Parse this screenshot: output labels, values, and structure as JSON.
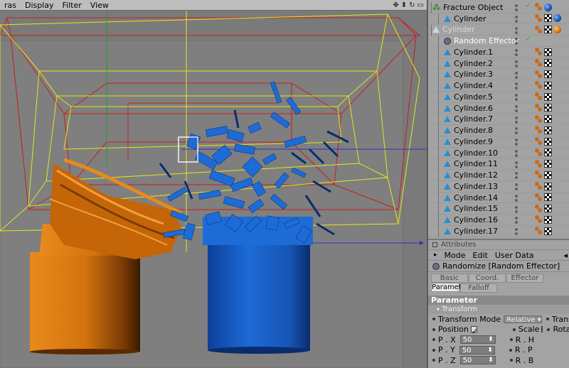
{
  "viewport": {
    "menu": [
      "ras",
      "Display",
      "Filter",
      "View"
    ]
  },
  "objects": [
    {
      "name": "Fracture Object",
      "kind": "fracture",
      "indent": 0,
      "check": "✓",
      "tags": [
        "phong",
        "sphere-blue"
      ]
    },
    {
      "name": "Cylinder",
      "kind": "tri",
      "indent": 1,
      "tags": [
        "phong",
        "check",
        "sphere-blue"
      ]
    },
    {
      "name": "Cylinder",
      "kind": "tri-ghost",
      "indent": 0,
      "tags": [
        "phong",
        "check",
        "sphere-orange"
      ]
    },
    {
      "name": "Random Effector",
      "kind": "effector",
      "indent": 1,
      "check": "✓",
      "tags": []
    },
    {
      "name": "Cylinder.1",
      "kind": "tri",
      "indent": 1,
      "tags": [
        "phong",
        "check"
      ]
    },
    {
      "name": "Cylinder.2",
      "kind": "tri",
      "indent": 1,
      "tags": [
        "phong",
        "check"
      ]
    },
    {
      "name": "Cylinder.3",
      "kind": "tri",
      "indent": 1,
      "tags": [
        "phong",
        "check"
      ]
    },
    {
      "name": "Cylinder.4",
      "kind": "tri",
      "indent": 1,
      "tags": [
        "phong",
        "check"
      ]
    },
    {
      "name": "Cylinder.5",
      "kind": "tri",
      "indent": 1,
      "tags": [
        "phong",
        "check"
      ]
    },
    {
      "name": "Cylinder.6",
      "kind": "tri",
      "indent": 1,
      "tags": [
        "phong",
        "check"
      ]
    },
    {
      "name": "Cylinder.7",
      "kind": "tri",
      "indent": 1,
      "tags": [
        "phong",
        "check"
      ]
    },
    {
      "name": "Cylinder.8",
      "kind": "tri",
      "indent": 1,
      "tags": [
        "phong",
        "check"
      ]
    },
    {
      "name": "Cylinder.9",
      "kind": "tri",
      "indent": 1,
      "tags": [
        "phong",
        "check"
      ]
    },
    {
      "name": "Cylinder.10",
      "kind": "tri",
      "indent": 1,
      "tags": [
        "phong",
        "check"
      ]
    },
    {
      "name": "Cylinder.11",
      "kind": "tri",
      "indent": 1,
      "tags": [
        "phong",
        "check"
      ]
    },
    {
      "name": "Cylinder.12",
      "kind": "tri",
      "indent": 1,
      "tags": [
        "phong",
        "check"
      ]
    },
    {
      "name": "Cylinder.13",
      "kind": "tri",
      "indent": 1,
      "tags": [
        "phong",
        "check"
      ]
    },
    {
      "name": "Cylinder.14",
      "kind": "tri",
      "indent": 1,
      "tags": [
        "phong",
        "check"
      ]
    },
    {
      "name": "Cylinder.15",
      "kind": "tri",
      "indent": 1,
      "tags": [
        "phong",
        "check"
      ]
    },
    {
      "name": "Cylinder.16",
      "kind": "tri",
      "indent": 1,
      "tags": [
        "phong",
        "check"
      ]
    },
    {
      "name": "Cylinder.17",
      "kind": "tri",
      "indent": 1,
      "tags": [
        "phong",
        "check"
      ]
    }
  ],
  "attributes": {
    "header": "Attributes",
    "menu": [
      "Mode",
      "Edit",
      "User Data"
    ],
    "title": "Randomize [Random Effector]",
    "tabs": [
      "Basic",
      "Coord.",
      "Effector",
      "Parameter",
      "Falloff"
    ],
    "active_tab": "Parameter",
    "section": "Parameter",
    "subsection": "Transform",
    "transform_mode_label": "Transform Mode",
    "transform_mode_value": "Relative",
    "transform_right": "Transform",
    "position_label": "Position",
    "scale_label": "Scale",
    "rotation_label": "Rotat",
    "p_x_label": "P . X",
    "p_y_label": "P . Y",
    "p_z_label": "P . Z",
    "p_x": "50",
    "p_y": "50",
    "p_z": "50",
    "r_h": "R . H",
    "r_p": "R . P",
    "r_b": "R . B"
  },
  "colors": {
    "blue_object": "#1d5fbf",
    "orange_object": "#d4730e",
    "wire_yellow": "#e6e61a",
    "wire_red": "#c81e1e"
  }
}
